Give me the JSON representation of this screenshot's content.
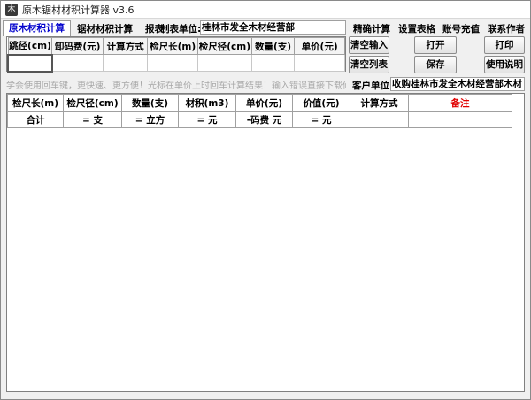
{
  "window": {
    "title": "原木锯材材积计算器 v3.6",
    "icon_glyph": "木"
  },
  "tabs": [
    {
      "label": "原木材积计算",
      "active": true
    },
    {
      "label": "锯材材积计算",
      "active": false
    },
    {
      "label": "报表",
      "active": false
    }
  ],
  "unit": {
    "label": "制表单位:",
    "value": "桂林市发全木材经营部"
  },
  "menu": {
    "precise": "精确计算",
    "table_settings": "设置表格",
    "recharge": "账号充值",
    "contact": "联系作者"
  },
  "input_table": {
    "headers": [
      "跳径(cm)",
      "卸码费(元)",
      "计算方式",
      "检尺长(m)",
      "检尺径(cm)",
      "数量(支)",
      "单价(元)"
    ]
  },
  "buttons": {
    "clear_input": "清空输入",
    "open": "打开",
    "print": "打印",
    "clear_list": "清空列表",
    "save": "保存",
    "help": "使用说明"
  },
  "hint": "学会使用回车键，更快速、更方便！光标在单价上时回车计算结果！输入错误直接下载修改。",
  "customer": {
    "label": "客户单位:",
    "value": "收购桂林市发全木材经营部木材"
  },
  "result_table": {
    "headers": [
      "检尺长(m)",
      "检尺径(cm)",
      "数量(支)",
      "材积(m3)",
      "单价(元)",
      "价值(元)",
      "计算方式",
      "备注"
    ],
    "total_row": [
      "合计",
      "= 支",
      "= 立方",
      "= 元",
      "-码费 元",
      "= 元",
      "",
      ""
    ]
  },
  "colors": {
    "active_tab": "#0000cc",
    "remark_header": "#e00000",
    "hint_text": "#a8a8a8"
  }
}
